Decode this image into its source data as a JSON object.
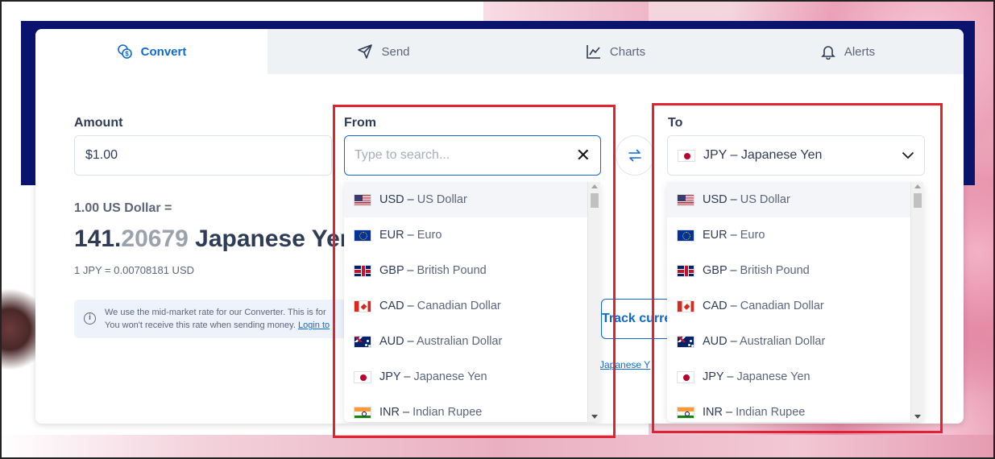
{
  "tabs": [
    {
      "label": "Convert",
      "icon": "coins-icon",
      "active": true
    },
    {
      "label": "Send",
      "icon": "paper-plane-icon",
      "active": false
    },
    {
      "label": "Charts",
      "icon": "line-chart-icon",
      "active": false
    },
    {
      "label": "Alerts",
      "icon": "bell-icon",
      "active": false
    }
  ],
  "amount": {
    "label": "Amount",
    "value": "$1.00"
  },
  "from": {
    "label": "From",
    "placeholder": "Type to search..."
  },
  "to": {
    "label": "To",
    "selected": "JPY – Japanese Yen"
  },
  "result": {
    "line1": "1.00 US Dollar =",
    "whole": "141.",
    "decimals": "20679",
    "currency": " Japanese Yen",
    "rate": "1 JPY = 0.00708181 USD"
  },
  "info": {
    "line1": "We use the mid-market rate for our Converter. This is for",
    "line2": "You won't receive this rate when sending money.",
    "login": "Login to"
  },
  "track_label": "Track curre",
  "small_link_prefix": "",
  "small_link": "Japanese Y",
  "currencies": [
    {
      "code": "USD",
      "name": "US Dollar",
      "flag": "usd"
    },
    {
      "code": "EUR",
      "name": "Euro",
      "flag": "eur"
    },
    {
      "code": "GBP",
      "name": "British Pound",
      "flag": "gbp"
    },
    {
      "code": "CAD",
      "name": "Canadian Dollar",
      "flag": "cad"
    },
    {
      "code": "AUD",
      "name": "Australian Dollar",
      "flag": "aud"
    },
    {
      "code": "JPY",
      "name": "Japanese Yen",
      "flag": "jpy"
    },
    {
      "code": "INR",
      "name": "Indian Rupee",
      "flag": "inr"
    }
  ],
  "colors": {
    "accent": "#0e6ad2",
    "highlight": "#e0232e",
    "hero": "#0a146e"
  }
}
